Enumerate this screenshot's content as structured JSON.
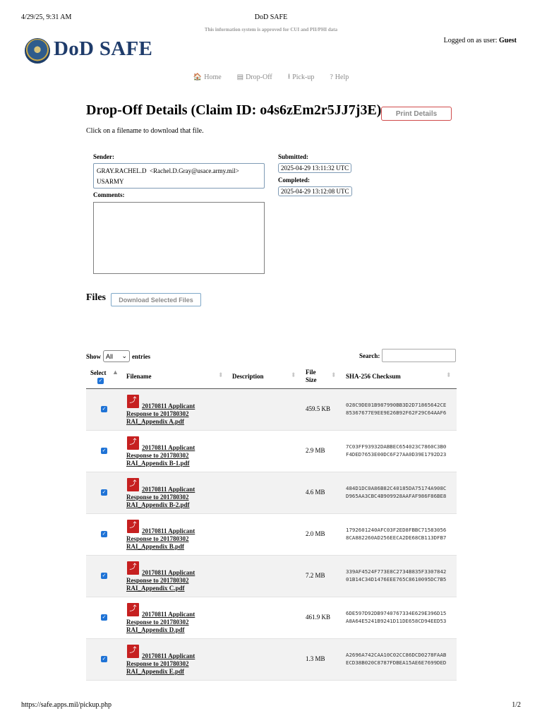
{
  "print_header": {
    "datetime": "4/29/25, 9:31 AM",
    "page_title": "DoD SAFE"
  },
  "notice": "This information system is approved for CUI and PII/PHI data",
  "logged_in": {
    "prefix": "Logged on as user:",
    "user": "Guest"
  },
  "logo_text": "DoD SAFE",
  "nav": [
    {
      "label": "Home",
      "icon": "home-icon",
      "glyph": "🏠"
    },
    {
      "label": "Drop-Off",
      "icon": "inbox-icon",
      "glyph": "▤"
    },
    {
      "label": "Pick-up",
      "icon": "download-icon",
      "glyph": "⭳"
    },
    {
      "label": "Help",
      "icon": "help-icon",
      "glyph": "?"
    }
  ],
  "title": "Drop-Off Details (Claim ID: o4s6zEm2r5JJ7j3E)",
  "print_button": "Print Details",
  "instructions": "Click on a filename to download that file.",
  "sender": {
    "label": "Sender:",
    "line1": "GRAY.RACHEL.D  <Rachel.D.Gray@usace.army.mil>",
    "line2": "USARMY"
  },
  "comments_label": "Comments:",
  "submitted": {
    "label": "Submitted:",
    "value": "2025-04-29 13:11:32 UTC"
  },
  "completed": {
    "label": "Completed:",
    "value": "2025-04-29 13:12:08 UTC"
  },
  "files_heading": "Files",
  "download_button": "Download Selected Files",
  "table_controls": {
    "show": "Show",
    "entries_value": "All",
    "entries": "entries",
    "search": "Search:"
  },
  "columns": {
    "select": "Select",
    "filename": "Filename",
    "description": "Description",
    "size_line1": "File",
    "size_line2": "Size",
    "checksum": "SHA-256 Checksum"
  },
  "files": [
    {
      "l1": "20170811 Applicant",
      "l2": "Response to 201780302",
      "l3": "RAI_Appendix A.pdf",
      "size": "459.5 KB",
      "h1": "028C9DE01B987990BB3D2D71865642CE",
      "h2": "85367677E9EE9E26B92F62F29C64AAF6"
    },
    {
      "l1": "20170811 Applicant",
      "l2": "Response to 201780302",
      "l3": "RAI_Appendix B-1.pdf",
      "size": "2.9 MB",
      "h1": "7C03FF93932DABBEC654023C7860C3B0",
      "h2": "F4DED7653E00DC6F27AA0D39E1792D23"
    },
    {
      "l1": "20170811 Applicant",
      "l2": "Response to 201780302",
      "l3": "RAI_Appendix B-2.pdf",
      "size": "4.6 MB",
      "h1": "484D1DC0A86B82C40185DA75174A908C",
      "h2": "D965AA3CBC4B909928AAFAF986F86BE8"
    },
    {
      "l1": "20170811 Applicant",
      "l2": "Response to 201780302",
      "l3": "RAI_Appendix B.pdf",
      "size": "2.0 MB",
      "h1": "1792601240AFC03F2ED8FBBC71583056",
      "h2": "8CA882260AD256EECA2DE68CB113DFB7"
    },
    {
      "l1": "20170811 Applicant",
      "l2": "Response to 201780302",
      "l3": "RAI_Appendix C.pdf",
      "size": "7.2 MB",
      "h1": "339AF4524F773E8C2734B835F3307842",
      "h2": "01B14C34D1476EEE765C8610095DC7B5"
    },
    {
      "l1": "20170811 Applicant",
      "l2": "Response to 201780302",
      "l3": "RAI_Appendix D.pdf",
      "size": "461.9 KB",
      "h1": "6DE597D92DB9740767334E629E396D15",
      "h2": "A8A64E5241B9241D11DE658CD94EED53"
    },
    {
      "l1": "20170811 Applicant",
      "l2": "Response to 201780302",
      "l3": "RAI_Appendix E.pdf",
      "size": "1.3 MB",
      "h1": "A2696A742CAA10C02CC86DCD0278FAAB",
      "h2": "ECD38B020C8787FDBEA15AE6E7699DED"
    }
  ],
  "footer": {
    "url": "https://safe.apps.mil/pickup.php",
    "page": "1/2"
  }
}
